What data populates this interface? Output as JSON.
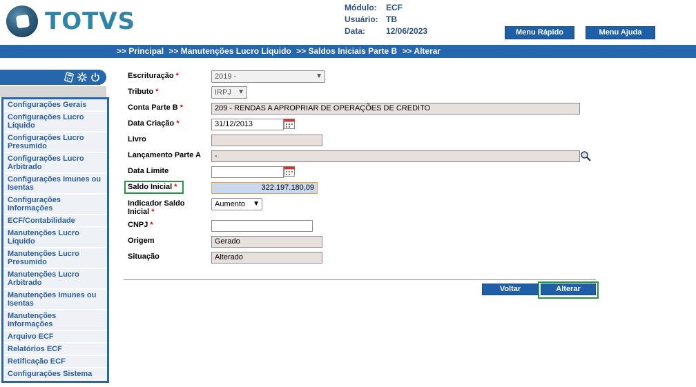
{
  "brand": {
    "name": "TOTVS"
  },
  "info": [
    {
      "key": "Módulo:",
      "value": "ECF"
    },
    {
      "key": "Usuário:",
      "value": "TB"
    },
    {
      "key": "Data:",
      "value": "12/06/2023"
    }
  ],
  "header_buttons": {
    "menu_rapido": "Menu Rápido",
    "menu_ajuda": "Menu Ajuda"
  },
  "breadcrumb": [
    ">> Principal",
    ">> Manutenções Lucro Líquido",
    ">> Saldos Iniciais Parte B",
    ">> Alterar"
  ],
  "sidebar": {
    "icons": [
      "calculator-icon",
      "gear-icon",
      "power-icon"
    ],
    "items": [
      "Configurações Gerais",
      "Configurações Lucro Líquido",
      "Configurações Lucro Presumido",
      "Configurações Lucro Arbitrado",
      "Configurações Imunes ou Isentas",
      "Configurações Informações",
      "ECF/Contabilidade",
      "Manutenções Lucro Líquido",
      "Manutenções Lucro Presumido",
      "Manutenções Lucro Arbitrado",
      "Manutenções Imunes ou Isentas",
      "Manutenções Informações",
      "Arquivo ECF",
      "Relatórios ECF",
      "Retificação ECF",
      "Configurações Sistema"
    ]
  },
  "form": {
    "escrituracao": {
      "label": "Escrituração",
      "required": "*",
      "value": "2019 -"
    },
    "tributo": {
      "label": "Tributo",
      "required": "*",
      "value": "IRPJ"
    },
    "conta_parte_b": {
      "label": "Conta Parte B",
      "required": "*",
      "value": "209 - RENDAS A APROPRIAR DE OPERAÇÕES DE CREDITO"
    },
    "data_criacao": {
      "label": "Data Criação",
      "required": "*",
      "value": "31/12/2013"
    },
    "livro": {
      "label": "Livro",
      "value": ""
    },
    "lancamento_parte_a": {
      "label": "Lançamento Parte A",
      "value": "-"
    },
    "data_limite": {
      "label": "Data Limite",
      "value": ""
    },
    "saldo_inicial": {
      "label": "Saldo Inicial",
      "required": "*",
      "value": "322.197.180,09"
    },
    "indicador_saldo_inicial": {
      "label_line1": "Indicador Saldo",
      "label_line2": "Inicial",
      "required": "*",
      "value": "Aumento"
    },
    "cnpj": {
      "label": "CNPJ",
      "required": "*",
      "value": ""
    },
    "origem": {
      "label": "Origem",
      "value": "Gerado"
    },
    "situacao": {
      "label": "Situação",
      "value": "Alterado"
    }
  },
  "actions": {
    "voltar": "Voltar",
    "alterar": "Alterar"
  },
  "colors": {
    "brand_blue": "#2566ad",
    "button_blue": "#1f5fa7",
    "highlight_green": "#1f9a40",
    "required_red": "#dd0000"
  }
}
